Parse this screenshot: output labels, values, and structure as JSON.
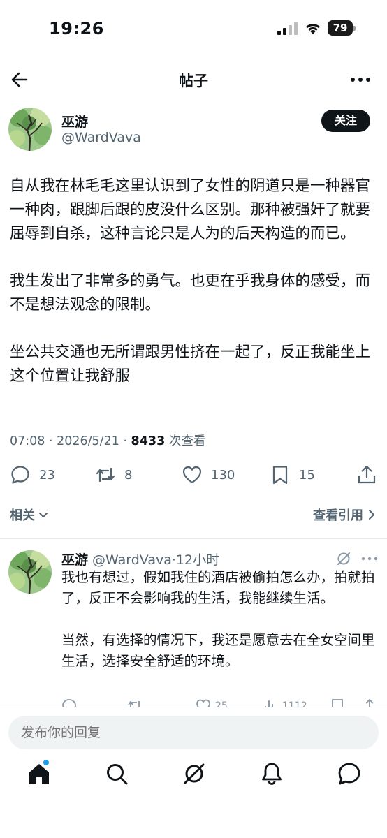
{
  "status_bar": {
    "time": "19:26",
    "battery": "79"
  },
  "header": {
    "title": "帖子"
  },
  "post": {
    "author_name": "巫游",
    "author_handle": "@WardVava",
    "follow_label": "关注",
    "paragraphs": [
      "自从我在林毛毛这里认识到了女性的阴道只是一种器官一种肉，跟脚后跟的皮没什么区别。那种被强奸了就要屈辱到自杀，这种言论只是人为的后天构造的而已。",
      "我生发出了非常多的勇气。也更在乎我身体的感受，而不是想法观念的限制。",
      "坐公共交通也无所谓跟男性挤在一起了，反正我能坐上这个位置让我舒服"
    ],
    "timestamp": "07:08 · 2026/5/21 · ",
    "views_count": "8433",
    "views_label": " 次查看",
    "actions": {
      "replies": "23",
      "reposts": "8",
      "likes": "130",
      "bookmarks": "15"
    }
  },
  "related": {
    "label": "相关",
    "quotes_label": "查看引用"
  },
  "reply": {
    "name": "巫游",
    "handle_time": " @WardVava·12小时",
    "paragraphs": [
      "我也有想过，假如我住的酒店被偷拍怎么办，拍就拍了，反正不会影响我的生活，我能继续生活。",
      "当然，有选择的情况下，我还是愿意去在全女空间里生活，选择安全舒适的环境。"
    ],
    "actions": {
      "likes": "25",
      "views": "1112"
    }
  },
  "composer": {
    "placeholder": "发布你的回复"
  },
  "icons": {
    "back": "back-arrow-icon",
    "more": "more-horizontal-icon",
    "reply": "reply-icon",
    "repost": "repost-icon",
    "like": "heart-icon",
    "bookmark": "bookmark-icon",
    "share": "share-icon",
    "grok": "grok-icon",
    "home": "home-icon",
    "search": "search-icon",
    "bell": "notifications-icon",
    "messages": "messages-icon"
  },
  "colors": {
    "accent": "#1d9bf0",
    "text": "#0f1419",
    "muted": "#536471"
  }
}
